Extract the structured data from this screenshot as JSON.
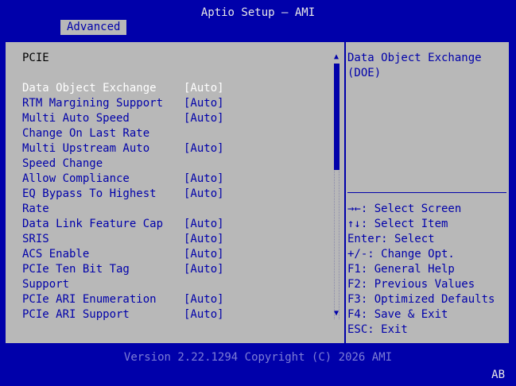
{
  "window": {
    "title": "Aptio Setup – AMI"
  },
  "tabs": [
    {
      "label": "Advanced"
    }
  ],
  "section": {
    "heading": "PCIE"
  },
  "settings": [
    {
      "label": "Data Object Exchange",
      "value": "[Auto]",
      "selected": true
    },
    {
      "label": "RTM Margining Support",
      "value": "[Auto]"
    },
    {
      "label": "Multi Auto Speed",
      "label2": "Change On Last Rate",
      "value": "[Auto]"
    },
    {
      "label": "Multi Upstream Auto",
      "label2": "Speed Change",
      "value": "[Auto]"
    },
    {
      "label": "Allow Compliance",
      "value": "[Auto]"
    },
    {
      "label": "EQ Bypass To Highest",
      "label2": "Rate",
      "value": "[Auto]"
    },
    {
      "label": "Data Link Feature Cap",
      "value": "[Auto]"
    },
    {
      "label": "SRIS",
      "value": "[Auto]"
    },
    {
      "label": "ACS Enable",
      "value": "[Auto]"
    },
    {
      "label": "PCIe Ten Bit Tag",
      "label2": "Support",
      "value": "[Auto]"
    },
    {
      "label": "PCIe ARI Enumeration",
      "value": "[Auto]"
    },
    {
      "label": "PCIe ARI Support",
      "value": "[Auto]"
    }
  ],
  "scrollbar": {
    "up_glyph": "▲",
    "down_glyph": "▼"
  },
  "help": {
    "text": "Data Object Exchange\n(DOE)"
  },
  "keys": [
    "→←: Select Screen",
    "↑↓: Select Item",
    "Enter: Select",
    "+/-: Change Opt.",
    "F1: General Help",
    "F2: Previous Values",
    "F3: Optimized Defaults",
    "F4: Save & Exit",
    "ESC: Exit"
  ],
  "footer": {
    "version": "Version 2.22.1294 Copyright (C) 2026 AMI",
    "corner": "AB"
  },
  "colors": {
    "background": "#0000aa",
    "panel": "#b8b8b8",
    "text": "#0000aa",
    "selected_text": "#ffffff"
  }
}
